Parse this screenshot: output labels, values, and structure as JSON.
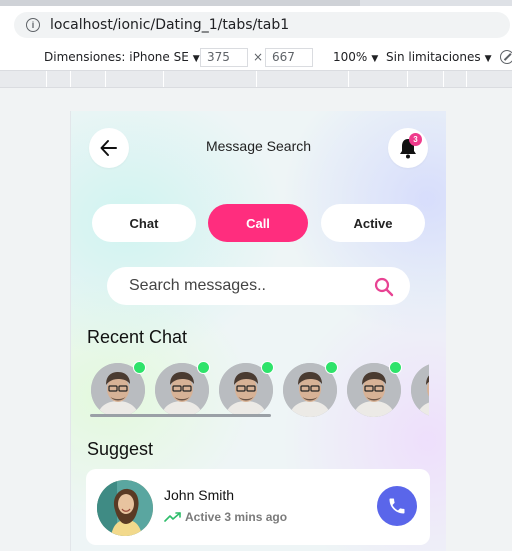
{
  "browser": {
    "url": "localhost/ionic/Dating_1/tabs/tab1"
  },
  "device_toolbar": {
    "dimensions_label": "Dimensiones: iPhone SE",
    "width_value": "375",
    "times": "×",
    "height_value": "667",
    "zoom": "100%",
    "throttle": "Sin limitaciones"
  },
  "header": {
    "title": "Message Search",
    "notification_count": "3"
  },
  "tabs": [
    {
      "label": "Chat",
      "active": false
    },
    {
      "label": "Call",
      "active": true
    },
    {
      "label": "Active",
      "active": false
    }
  ],
  "search": {
    "placeholder": "Search messages.."
  },
  "recent_chat": {
    "title": "Recent Chat",
    "count": 6
  },
  "suggest": {
    "title": "Suggest",
    "items": [
      {
        "name": "John Smith",
        "status": "Active 3 mins ago"
      }
    ]
  },
  "colors": {
    "accent_pink": "#ff2d7e",
    "call_blue": "#5a66ea",
    "online_green": "#2ee36a",
    "search_icon_pink": "#e84393"
  }
}
